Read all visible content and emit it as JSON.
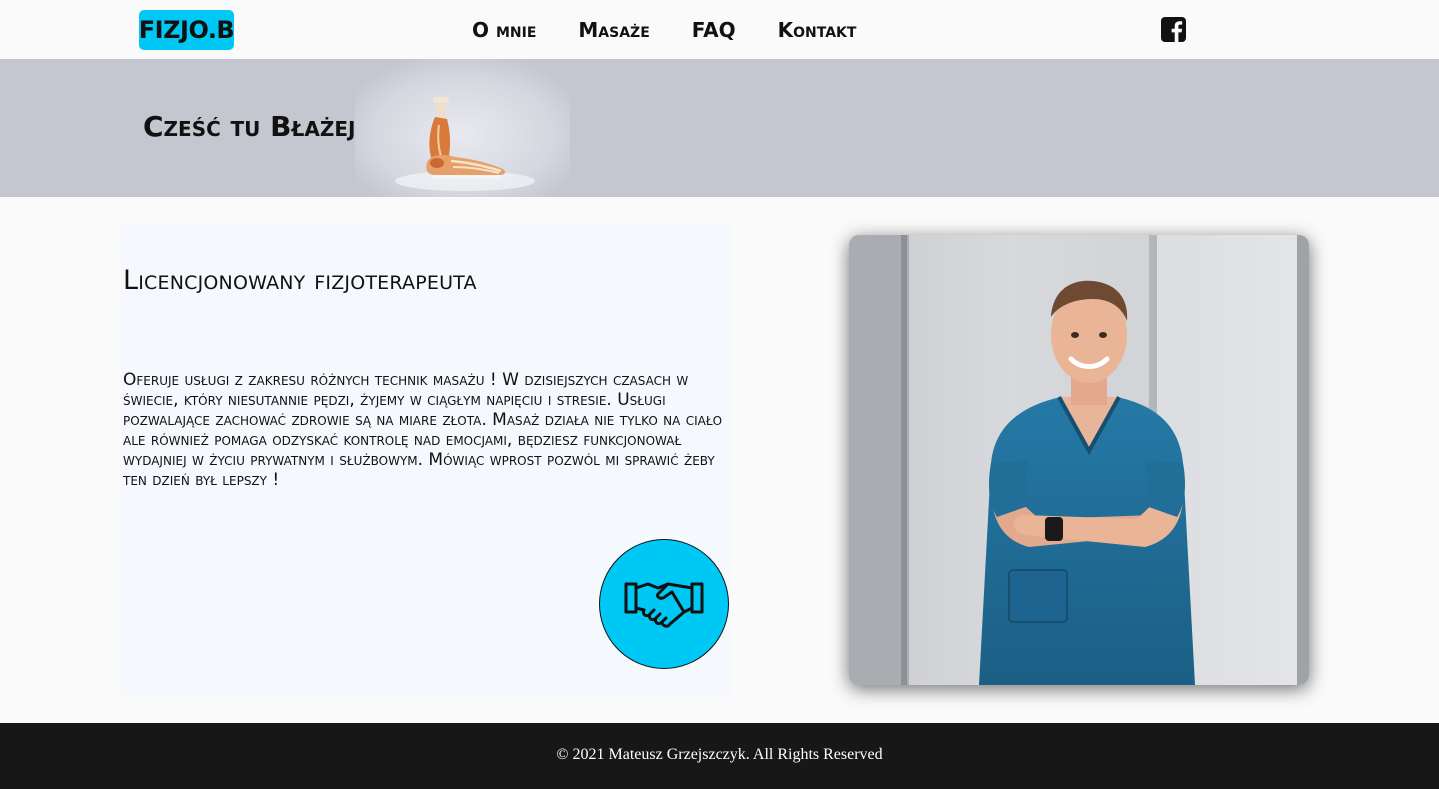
{
  "navbar": {
    "logo": "FIZJO.B",
    "links": [
      "O mnie",
      "Masaże",
      "FAQ",
      "Kontakt"
    ],
    "social_icon": "facebook-square-icon"
  },
  "hero": {
    "title": "Cześć tu Błażej !",
    "image": "foot-anatomy-model"
  },
  "about": {
    "title": "Licencjonowany fizjoterapeuta",
    "text": "Oferuje usługi z zakresu różnych technik masażu ! W dzisiejszych czasach w świecie, który niesutannie pędzi, żyjemy w ciągłym napięciu i stresie. Usługi pozwalające zachować zdrowie są na miare złota. Masaż działa nie tylko na ciało ale również pomaga odzyskać kontrolę nad emocjami, będziesz funkcjonował wydajniej w życiu prywatnym i służbowym. Mówiąc wprost pozwól mi sprawić żeby ten dzień był lepszy !",
    "button_icon": "handshake-icon",
    "photo": "therapist-portrait"
  },
  "footer": {
    "copyright": "© 2021 Mateusz Grzejszczyk. All Rights Reserved"
  },
  "colors": {
    "accent": "#00c8f5",
    "hero_bg": "#c4c7d0",
    "footer_bg": "#171717",
    "scrubs": "#1f6f99"
  }
}
